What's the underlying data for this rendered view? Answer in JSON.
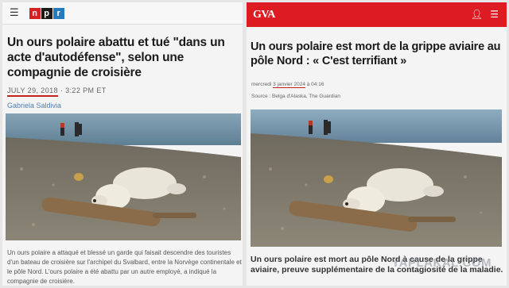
{
  "npr": {
    "menu_icon": "hamburger-icon",
    "logo_letters": [
      "n",
      "p",
      "r"
    ],
    "headline": "Un ours polaire abattu et tué \"dans un acte d'autodéfense\", selon une compagnie de croisière",
    "date": "JULY 29, 2018",
    "time": " · 3:22 PM ET",
    "byline": "Gabriela Saldivia",
    "caption": "Un ours polaire a attaqué et blessé un garde qui faisait descendre des touristes d'un bateau de croisière sur l'archipel du Svalbard, entre la Norvège continentale et le pôle Nord. L'ours polaire a été abattu par un autre employé, a indiqué la compagnie de croisière."
  },
  "gva": {
    "logo": "GVA",
    "user_icon": "user-icon",
    "menu_icon": "hamburger-icon",
    "headline": "Un ours polaire est mort de la grippe aviaire au pôle Nord : « C'est terrifiant »",
    "date_prefix": "mercredi ",
    "date_link": "3 janvier 2024",
    "date_suffix": " à 04:16",
    "source": "Source : Belga d'Alaska, The Guardian",
    "caption": "Un ours polaire est mort au pôle Nord à cause de la grippe aviaire, preuve supplémentaire de la contagiosité de la maladie."
  },
  "watermark": "YAPLAKAL.COM",
  "colors": {
    "npr_red": "#d62021",
    "npr_black": "#1a1a1a",
    "npr_blue": "#237bbd",
    "gva_red": "#dc1b22"
  }
}
